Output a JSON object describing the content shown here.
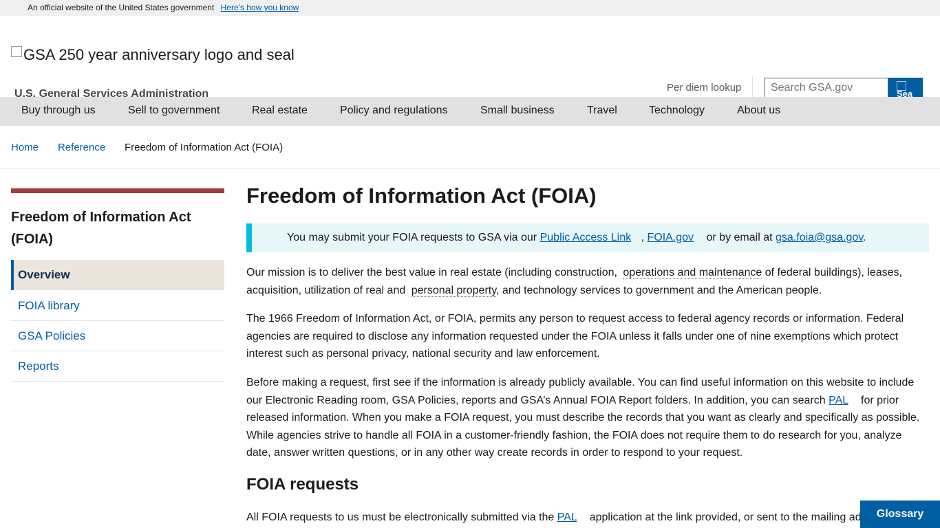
{
  "banner": {
    "text": "An official website of the United States government",
    "link": "Here's how you know"
  },
  "header": {
    "logo_alt": "GSA 250 year anniversary logo and seal",
    "agency_name": "U.S. General Services Administration",
    "per_diem_link": "Per diem lookup",
    "search_placeholder": "Search GSA.gov",
    "search_button_text": "Sea"
  },
  "nav": {
    "items": [
      "Buy through us",
      "Sell to government",
      "Real estate",
      "Policy and regulations",
      "Small business",
      "Travel",
      "Technology",
      "About us"
    ]
  },
  "breadcrumb": {
    "items": [
      "Home",
      "Reference",
      "Freedom of Information Act (FOIA)"
    ]
  },
  "sidenav": {
    "title": "Freedom of Information Act (FOIA)",
    "items": [
      "Overview",
      "FOIA library",
      "GSA Policies",
      "Reports"
    ],
    "active_index": 0
  },
  "main": {
    "title": "Freedom of Information Act (FOIA)",
    "alert": {
      "text_before": "You may submit your FOIA requests to GSA via our",
      "link1": "Public Access Link",
      "sep": ",",
      "link2": "FOIA.gov",
      "text_mid": "or by email at",
      "email": "gsa.foia@gsa.gov",
      "end": "."
    },
    "p1": {
      "a": "Our mission is to deliver the best value in real estate (including construction,",
      "term1": "operations and maintenance",
      "b": "of federal buildings), leases, acquisition, utilization of real and",
      "term2": "personal property",
      "c": ", and technology services to government and the American people."
    },
    "p2": "The 1966 Freedom of Information Act, or FOIA, permits any person to request access to federal agency records or information. Federal agencies are required to disclose any information requested under the FOIA unless it falls under one of nine exemptions which protect interest such as personal privacy, national security and law enforcement.",
    "p3": {
      "a": "Before making a request, first see if the information is already publicly available. You can find useful information on this website to include our Electronic Reading room, GSA Policies, reports and GSA’s Annual FOIA Report folders. In addition, you can search",
      "link": "PAL",
      "b": "for prior released information. When you make a FOIA request, you must describe the records that you want as clearly and specifically as possible. While agencies strive to handle all FOIA in a customer-friendly fashion, the FOIA does not require them to do research for you, analyze date, answer written questions, or in any other way create records in order to respond to your request."
    },
    "h2": "FOIA requests",
    "p4": {
      "a": "All FOIA requests to us must be electronically submitted via the",
      "link": "PAL",
      "b": "application at the link provided, or sent to the mailing ad"
    }
  },
  "glossary_button": "Glossary"
}
